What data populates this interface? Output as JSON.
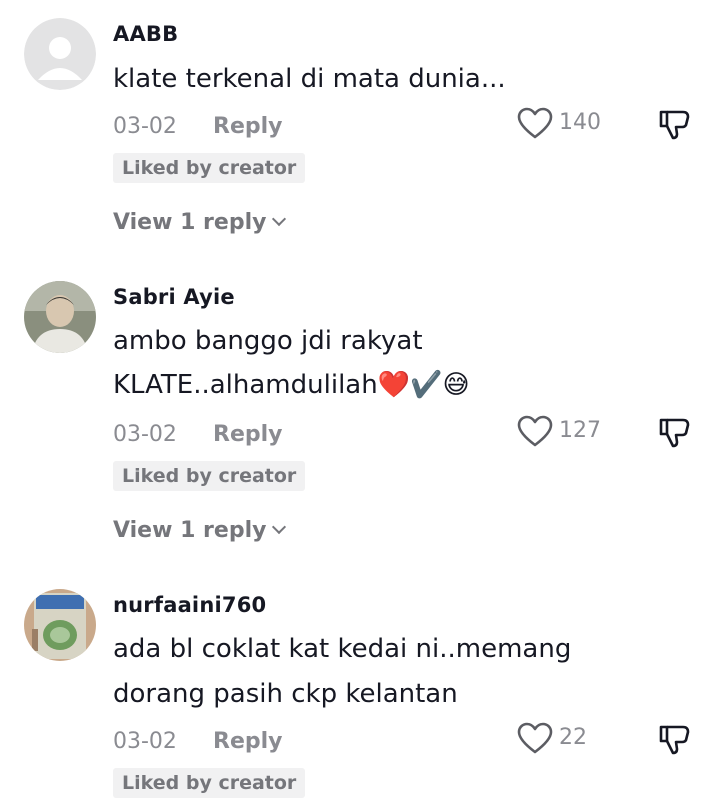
{
  "colors": {
    "text_primary": "#161823",
    "text_secondary": "#8a8b91",
    "badge_bg": "#f1f1f2",
    "badge_text": "#75767b"
  },
  "comments": [
    {
      "username": "AABB",
      "avatar": "default-avatar",
      "lines": [
        "klate terkenal di mata dunia..."
      ],
      "date": "03-02",
      "reply_label": "Reply",
      "likes": "140",
      "liked_badge": "Liked by creator",
      "view_replies": "View 1 reply"
    },
    {
      "username": "Sabri Ayie",
      "avatar": "photo-avatar",
      "lines": [
        "ambo banggo jdi rakyat",
        "KLATE..alhamdulilah"
      ],
      "emojis": [
        "❤️",
        "✔️",
        "😅"
      ],
      "date": "03-02",
      "reply_label": "Reply",
      "likes": "127",
      "liked_badge": "Liked by creator",
      "view_replies": "View 1 reply"
    },
    {
      "username": "nurfaaini760",
      "avatar": "book-cover-avatar",
      "avatar_text": "TAJWID",
      "lines": [
        "ada bl coklat kat kedai ni..memang",
        "dorang pasih ckp kelantan"
      ],
      "date": "03-02",
      "reply_label": "Reply",
      "likes": "22",
      "liked_badge": "Liked by creator"
    }
  ],
  "icons": {
    "like": "heart-outline-icon",
    "dislike": "thumbs-down-icon",
    "expand": "chevron-down-icon"
  }
}
